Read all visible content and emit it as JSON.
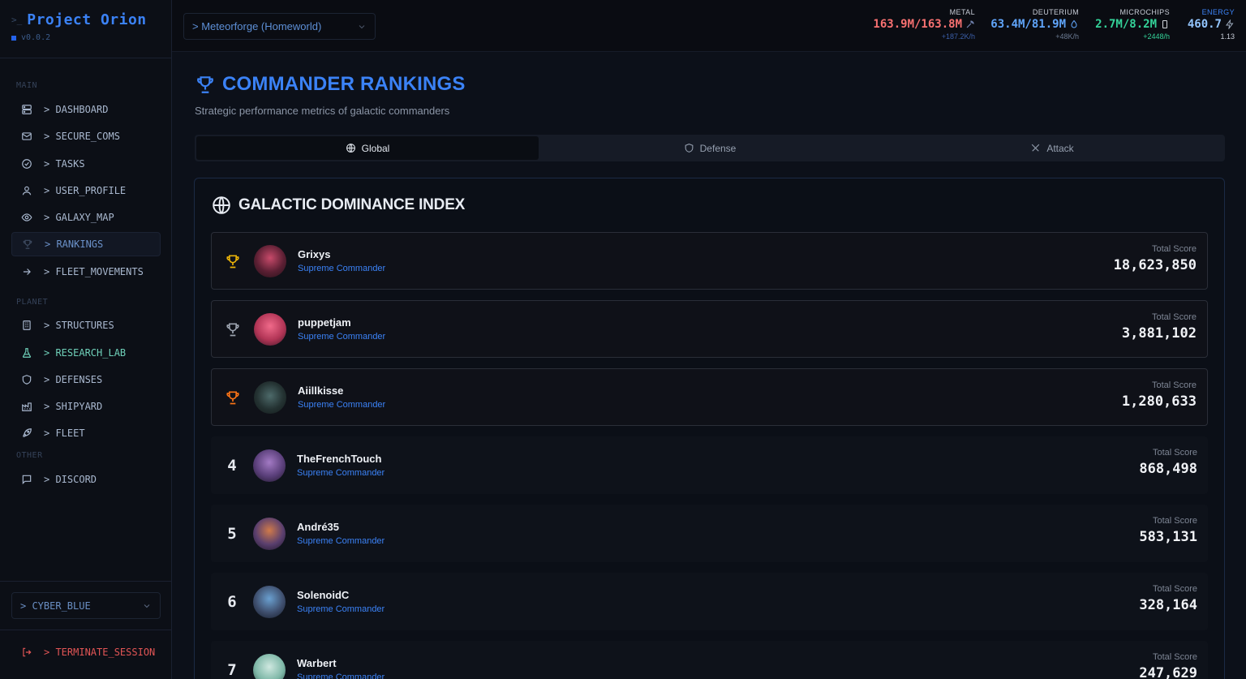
{
  "app": {
    "title": "Project Orion",
    "version": "v0.0.2"
  },
  "sidebar": {
    "sections": {
      "main": "MAIN",
      "planet": "PLANET",
      "other": "OTHER"
    },
    "items": [
      {
        "label": "> DASHBOARD",
        "icon": "server-icon"
      },
      {
        "label": "> SECURE_COMS",
        "icon": "mail-icon"
      },
      {
        "label": "> TASKS",
        "icon": "check-circle-icon"
      },
      {
        "label": "> USER_PROFILE",
        "icon": "user-icon"
      },
      {
        "label": "> GALAXY_MAP",
        "icon": "eye-icon"
      },
      {
        "label": "> RANKINGS",
        "icon": "trophy-icon"
      },
      {
        "label": "> FLEET_MOVEMENTS",
        "icon": "arrow-right-icon"
      },
      {
        "label": "> STRUCTURES",
        "icon": "building-icon"
      },
      {
        "label": "> RESEARCH_LAB",
        "icon": "flask-icon"
      },
      {
        "label": "> DEFENSES",
        "icon": "shield-icon"
      },
      {
        "label": "> SHIPYARD",
        "icon": "factory-icon"
      },
      {
        "label": "> FLEET",
        "icon": "rocket-icon"
      },
      {
        "label": "> DISCORD",
        "icon": "message-icon"
      }
    ],
    "theme": "> CYBER_BLUE",
    "logout": "> TERMINATE_SESSION"
  },
  "topbar": {
    "planet": "> Meteorforge (Homeworld)",
    "resources": [
      {
        "name": "METAL",
        "value": "163.9M/163.8M",
        "rate": "+187.2K/h",
        "color": "#f87171",
        "icon": "pickaxe-icon"
      },
      {
        "name": "DEUTERIUM",
        "value": "63.4M/81.9M",
        "rate": "+48K/h",
        "color": "#60a5fa",
        "icon": "droplet-icon"
      },
      {
        "name": "MICROCHIPS",
        "value": "2.7M/8.2M",
        "rate": "+2448/h",
        "color": "#34d399",
        "icon": "chip-icon"
      },
      {
        "name": "ENERGY",
        "value": "460.7",
        "rate": "1.13",
        "color": "#93c5fd",
        "icon": "bolt-icon"
      }
    ]
  },
  "page": {
    "title": "COMMANDER RANKINGS",
    "subtitle": "Strategic performance metrics of galactic commanders",
    "tabs": [
      {
        "label": "Global",
        "icon": "globe-icon",
        "active": true
      },
      {
        "label": "Defense",
        "icon": "shield-icon",
        "active": false
      },
      {
        "label": "Attack",
        "icon": "swords-icon",
        "active": false
      }
    ]
  },
  "rankings": {
    "title": "GALACTIC DOMINANCE INDEX",
    "score_label": "Total Score",
    "players": [
      {
        "rank": "1",
        "name": "Grixys",
        "role": "Supreme Commander",
        "score": "18,623,850",
        "trophy": "#eab308",
        "avatar_color": "#8b2c4a"
      },
      {
        "rank": "2",
        "name": "puppetjam",
        "role": "Supreme Commander",
        "score": "3,881,102",
        "trophy": "#9ca3af",
        "avatar_color": "#c2416a"
      },
      {
        "rank": "3",
        "name": "Aiillkisse",
        "role": "Supreme Commander",
        "score": "1,280,633",
        "trophy": "#f97316",
        "avatar_color": "#2d3a3a"
      },
      {
        "rank": "4",
        "name": "TheFrenchTouch",
        "role": "Supreme Commander",
        "score": "868,498",
        "avatar_color": "#6b4a8a"
      },
      {
        "rank": "5",
        "name": "André35",
        "role": "Supreme Commander",
        "score": "583,131",
        "avatar_color": "#5a3f6e"
      },
      {
        "rank": "6",
        "name": "SolenoidC",
        "role": "Supreme Commander",
        "score": "328,164",
        "avatar_color": "#3f4f6e"
      },
      {
        "rank": "7",
        "name": "Warbert",
        "role": "Supreme Commander",
        "score": "247,629",
        "avatar_color": "#7fb8a8"
      }
    ]
  }
}
